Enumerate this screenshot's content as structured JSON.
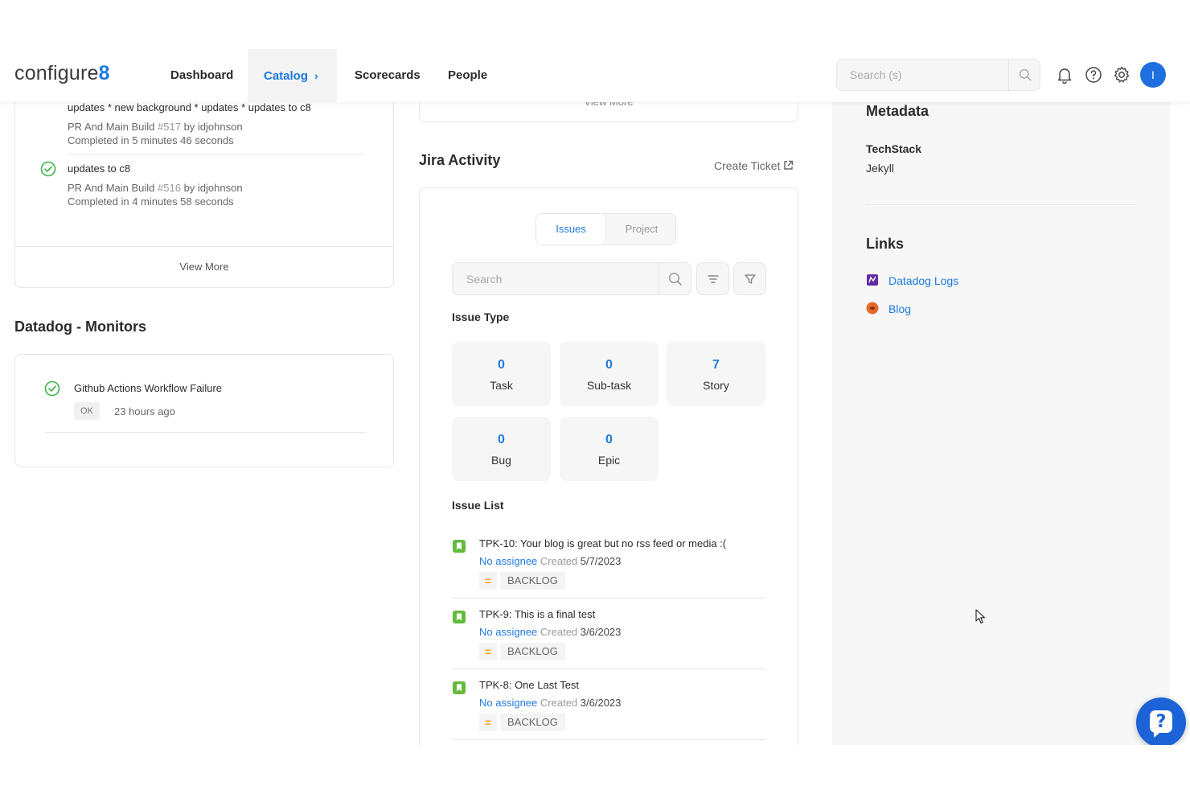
{
  "header": {
    "logo_text": "configure",
    "logo_mark": "8",
    "nav": [
      {
        "label": "Dashboard"
      },
      {
        "label": "Catalog",
        "chevron": "›"
      },
      {
        "label": "Scorecards"
      },
      {
        "label": "People"
      }
    ],
    "search_placeholder": "Search (s)",
    "avatar_initial": "I"
  },
  "builds": {
    "items": [
      {
        "title": "updates * new background * updates * updates to c8",
        "pipeline": "PR And Main Build",
        "run": "#517",
        "by": "by idjohnson",
        "duration": "Completed in 5 minutes 46 seconds"
      },
      {
        "title": "updates to c8",
        "pipeline": "PR And Main Build",
        "run": "#516",
        "by": "by idjohnson",
        "duration": "Completed in 4 minutes 58 seconds"
      }
    ],
    "view_more": "View More"
  },
  "datadog": {
    "title": "Datadog - Monitors",
    "monitor_name": "Github Actions Workflow Failure",
    "status": "OK",
    "time": "23 hours ago"
  },
  "jira": {
    "top_view_more": "View More",
    "title": "Jira Activity",
    "create_ticket": "Create Ticket",
    "tabs": [
      {
        "label": "Issues"
      },
      {
        "label": "Project"
      }
    ],
    "search_placeholder": "Search",
    "issue_type_heading": "Issue Type",
    "issue_types": [
      {
        "count": "0",
        "label": "Task"
      },
      {
        "count": "0",
        "label": "Sub-task"
      },
      {
        "count": "7",
        "label": "Story"
      },
      {
        "count": "0",
        "label": "Bug"
      },
      {
        "count": "0",
        "label": "Epic"
      }
    ],
    "issue_list_heading": "Issue List",
    "issues": [
      {
        "title": "TPK-10: Your blog is great but no rss feed or media :(",
        "assignee": "No assignee",
        "created_label": "Created",
        "date": "5/7/2023",
        "priority": "=",
        "status": "BACKLOG"
      },
      {
        "title": "TPK-9: This is a final test",
        "assignee": "No assignee",
        "created_label": "Created",
        "date": "3/6/2023",
        "priority": "=",
        "status": "BACKLOG"
      },
      {
        "title": "TPK-8: One Last Test",
        "assignee": "No assignee",
        "created_label": "Created",
        "date": "3/6/2023",
        "priority": "=",
        "status": "BACKLOG"
      }
    ]
  },
  "sidebar": {
    "metadata_title": "Metadata",
    "techstack_label": "TechStack",
    "techstack_value": "Jekyll",
    "links_title": "Links",
    "links": [
      {
        "label": "Datadog Logs",
        "icon": "datadog-icon"
      },
      {
        "label": "Blog",
        "icon": "blog-icon"
      }
    ]
  },
  "colors": {
    "accent": "#1f7ae0",
    "success": "#3cb44b",
    "priority": "#f0a020"
  }
}
